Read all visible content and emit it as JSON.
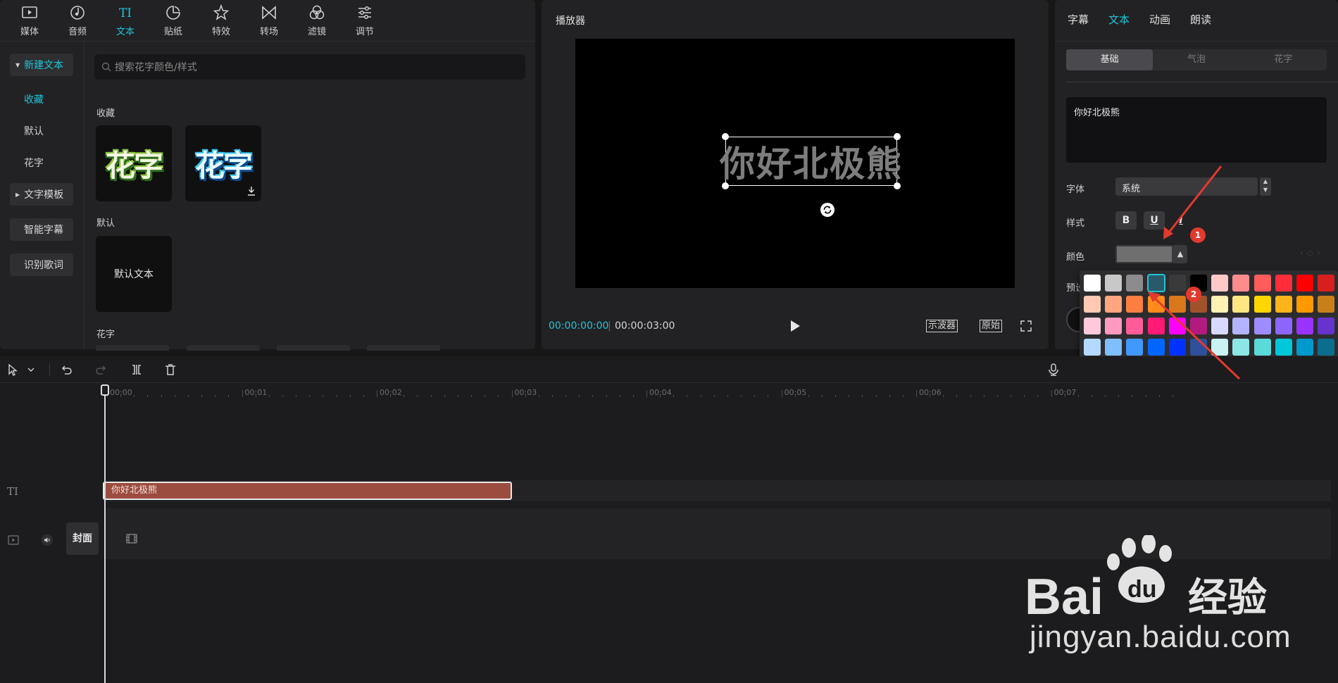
{
  "top_nav": {
    "items": [
      {
        "label": "媒体",
        "icon": "media-icon"
      },
      {
        "label": "音频",
        "icon": "audio-icon"
      },
      {
        "label": "文本",
        "icon": "text-icon",
        "active": true
      },
      {
        "label": "贴纸",
        "icon": "sticker-icon"
      },
      {
        "label": "特效",
        "icon": "effects-icon"
      },
      {
        "label": "转场",
        "icon": "transition-icon"
      },
      {
        "label": "滤镜",
        "icon": "filter-icon"
      },
      {
        "label": "调节",
        "icon": "adjust-icon"
      }
    ]
  },
  "sidebar": {
    "new_text": "新建文本",
    "favorites": "收藏",
    "default": "默认",
    "huazi": "花字",
    "templates": "文字模板",
    "smart_captions": "智能字幕",
    "lyrics": "识别歌词"
  },
  "library": {
    "search_placeholder": "搜索花字颜色/样式",
    "section_favorites": "收藏",
    "section_default": "默认",
    "section_huazi": "花字",
    "tile_huazi_1": "花字",
    "tile_huazi_2": "花字",
    "tile_default": "默认文本"
  },
  "player": {
    "title": "播放器",
    "overlay_text": "你好北极熊",
    "time_current": "00:00:00:00",
    "time_total": "00:00:03:00",
    "btn_scope": "示波器",
    "btn_original": "原始"
  },
  "inspector": {
    "tabs": [
      "字幕",
      "文本",
      "动画",
      "朗读"
    ],
    "active_tab": "文本",
    "subtabs": [
      "基础",
      "气泡",
      "花字"
    ],
    "text_value": "你好北极熊",
    "font_label": "字体",
    "font_value": "系统",
    "style_label": "样式",
    "style_bold": "B",
    "style_underline": "U",
    "style_italic": "I",
    "color_label": "颜色",
    "color_value": "#6f6f6f",
    "preset_label": "预设"
  },
  "color_palette": {
    "selected": "#2a5a6a",
    "rows": [
      [
        "#ffffff",
        "#c8c8c8",
        "#8c8c8c",
        "#2a5a6a",
        "#3a3a3a",
        "#000000",
        "#ffc9c9",
        "#ff8c8c",
        "#ff5c5c",
        "#ff2d3a",
        "#ff0000",
        "#d81e1e"
      ],
      [
        "#ffc9b3",
        "#ffa680",
        "#ff7f40",
        "#ff8c1a",
        "#d9781a",
        "#a0522d",
        "#fff2b3",
        "#ffe680",
        "#ffd700",
        "#ffb31a",
        "#ff9900",
        "#c87f1a"
      ],
      [
        "#ffc9dc",
        "#ff99bf",
        "#ff5c99",
        "#ff1a75",
        "#ff00ff",
        "#b31a80",
        "#d9d9ff",
        "#b3b3ff",
        "#9f8cff",
        "#8c66ff",
        "#9933ff",
        "#6633cc"
      ],
      [
        "#b3d9ff",
        "#80bfff",
        "#4099ff",
        "#0066ff",
        "#0033ff",
        "#2e4f99",
        "#c9f2f2",
        "#8ce6e6",
        "#5cd9d9",
        "#00c8d9",
        "#0099cc",
        "#0a6e8c"
      ],
      [
        "#b3f2c9",
        "#66e6a0",
        "#1ad98c",
        "#1acc4d",
        "#00e64d",
        "#1a8c40",
        "#e6f2b3",
        "#c8d94d",
        "#99b31a",
        "#6e9a1a",
        "#4d8c33",
        "#2e6e2e"
      ],
      [
        "#d9c9c0",
        "#b3a699",
        "#8c7a6e",
        "#8c6e59",
        "#7a6459",
        "#594a40",
        "#f2c9b3",
        "#e6806e",
        "#cc5a5a",
        "#e6a680",
        "#d9804d",
        "#b36633"
      ],
      [
        "#e6cc8c",
        "#e6b340",
        "#cca64d",
        "#b3b366",
        "#8c9966",
        "#5a7a59",
        "#6e9a99",
        "#1a998c",
        "#2e8c73",
        "#80b3c0",
        "#5ab3c0",
        "#1a80b3"
      ],
      [
        "#a6b8d9",
        "#7390cc",
        "#3a4a6e",
        "#d9b3c9",
        "#b393b3",
        "#804d73"
      ]
    ]
  },
  "timeline": {
    "ruler_labels": [
      "00:00",
      "00:01",
      "00:02",
      "00:03",
      "00:04",
      "00:05",
      "00:06",
      "00:07"
    ],
    "text_track_label": "TI",
    "text_clip": "你好北极熊",
    "cover_label": "封面"
  },
  "annotations": {
    "badge_1": "1",
    "badge_2": "2"
  },
  "watermark": {
    "logo_text": "Bai",
    "logo_du": "du",
    "logo_cn": "经验",
    "url": "jingyan.baidu.com"
  }
}
